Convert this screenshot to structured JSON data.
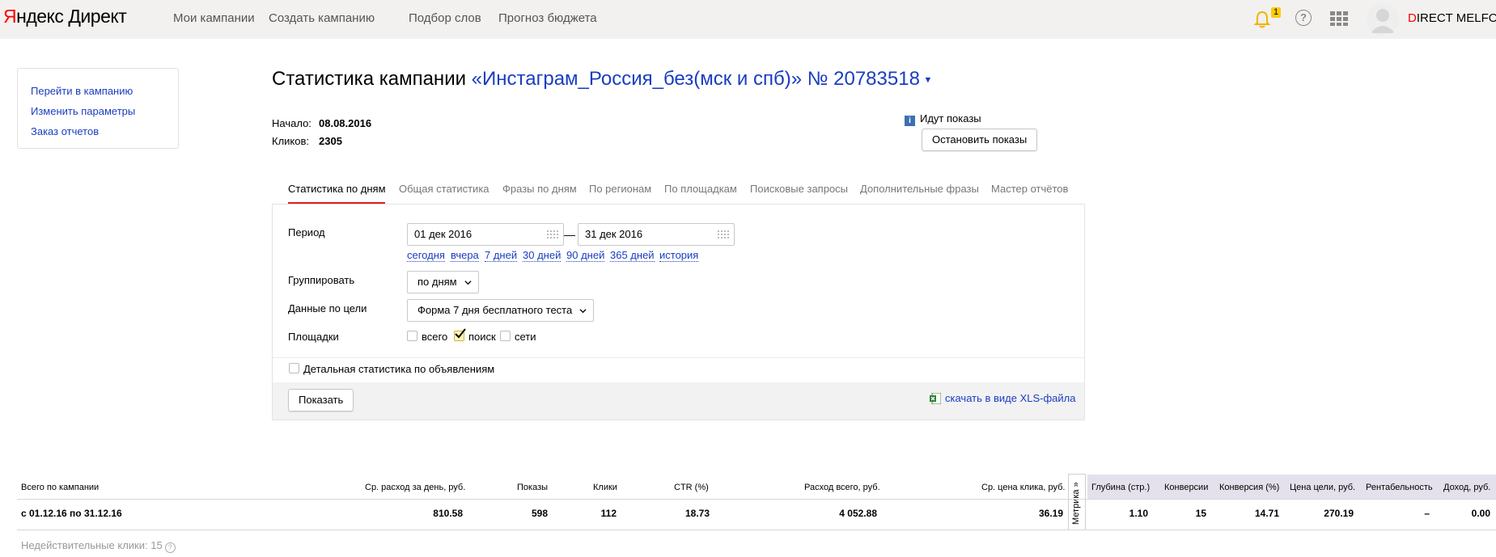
{
  "header": {
    "logo_part1": "Я",
    "logo_part2": "ндекс",
    "logo_part3": "Директ",
    "nav": [
      "Мои кампании",
      "Создать кампанию",
      "Подбор слов",
      "Прогноз бюджета"
    ],
    "notification_count": "1",
    "help_label": "?",
    "user_first": "D",
    "user_rest": "IRECT MELFO"
  },
  "sidebar": {
    "links": [
      "Перейти в кампанию",
      "Изменить параметры",
      "Заказ отчетов"
    ]
  },
  "title": {
    "prefix": "Статистика кампании",
    "campaign": "«Инстаграм_Россия_без(мск и спб)» № 20783518",
    "arrow": "▾"
  },
  "info": {
    "start_label": "Начало:",
    "start_value": "08.08.2016",
    "clicks_label": "Кликов:",
    "clicks_value": "2305"
  },
  "status": {
    "text": "Идут показы",
    "icon_letter": "i",
    "stop_button": "Остановить показы"
  },
  "tabs": [
    "Статистика по дням",
    "Общая статистика",
    "Фразы по дням",
    "По регионам",
    "По площадкам",
    "Поисковые запросы",
    "Дополнительные фразы",
    "Мастер отчётов"
  ],
  "form": {
    "period_label": "Период",
    "date_from": "01 дек 2016",
    "date_to": "31 дек 2016",
    "dash": "—",
    "quick_ranges": [
      "сегодня",
      "вчера",
      "7 дней",
      "30 дней",
      "90 дней",
      "365 дней",
      "история"
    ],
    "group_label": "Группировать",
    "group_value": "по дням",
    "goal_label": "Данные по цели",
    "goal_value": "Форма 7 дня бесплатного теста",
    "sites_label": "Площадки",
    "sites": [
      {
        "label": "всего",
        "checked": false
      },
      {
        "label": "поиск",
        "checked": true
      },
      {
        "label": "сети",
        "checked": false
      }
    ],
    "detail_label": "Детальная статистика по объявлениям",
    "show_button": "Показать",
    "xls_link": "скачать в виде XLS-файла"
  },
  "table": {
    "headers": [
      "Всего по кампании",
      "Ср. расход за день, руб.",
      "Показы",
      "Клики",
      "CTR (%)",
      "Расход всего, руб.",
      "Ср. цена клика, руб.",
      "Глубина (стр.)",
      "Конверсии",
      "Конверсия (%)",
      "Цена цели, руб.",
      "Рентабельность",
      "Доход, руб."
    ],
    "metrika_label": "Метрика »",
    "row": [
      "с 01.12.16 по 31.12.16",
      "810.58",
      "598",
      "112",
      "18.73",
      "4 052.88",
      "36.19",
      "1.10",
      "15",
      "14.71",
      "270.19",
      "–",
      "0.00"
    ],
    "invalid_clicks": "Недействительные клики: 15",
    "qmark": "?"
  },
  "colors": {
    "link": "#1a3dc1",
    "active_tab_underline": "#e02020",
    "metrika_header_bg": "#e4e1ec",
    "header_bg": "#f2f1f0"
  }
}
